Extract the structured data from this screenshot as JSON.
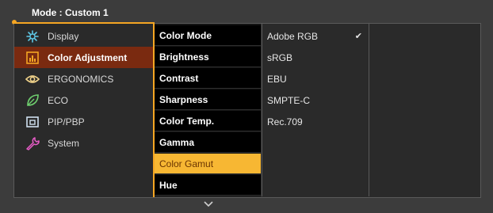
{
  "header": {
    "mode_label": "Mode : Custom 1"
  },
  "colors": {
    "accent": "#f5a623",
    "active_bg": "#7a2a10",
    "selected_bg": "#f7b733"
  },
  "main_menu": [
    {
      "label": "Display",
      "icon": "display-icon",
      "active": false
    },
    {
      "label": "Color Adjustment",
      "icon": "color-adjustment-icon",
      "active": true
    },
    {
      "label": "ERGONOMICS",
      "icon": "eye-icon",
      "active": false
    },
    {
      "label": "ECO",
      "icon": "leaf-icon",
      "active": false
    },
    {
      "label": "PIP/PBP",
      "icon": "pip-icon",
      "active": false
    },
    {
      "label": "System",
      "icon": "wrench-icon",
      "active": false
    }
  ],
  "sub_menu": [
    {
      "label": "Color Mode",
      "selected": false
    },
    {
      "label": "Brightness",
      "selected": false
    },
    {
      "label": "Contrast",
      "selected": false
    },
    {
      "label": "Sharpness",
      "selected": false
    },
    {
      "label": "Color Temp.",
      "selected": false
    },
    {
      "label": "Gamma",
      "selected": false
    },
    {
      "label": "Color Gamut",
      "selected": true
    },
    {
      "label": "Hue",
      "selected": false
    }
  ],
  "options": [
    {
      "label": "Adobe RGB",
      "checked": true
    },
    {
      "label": "sRGB",
      "checked": false
    },
    {
      "label": "EBU",
      "checked": false
    },
    {
      "label": "SMPTE-C",
      "checked": false
    },
    {
      "label": "Rec.709",
      "checked": false
    }
  ],
  "check_glyph": "✔"
}
